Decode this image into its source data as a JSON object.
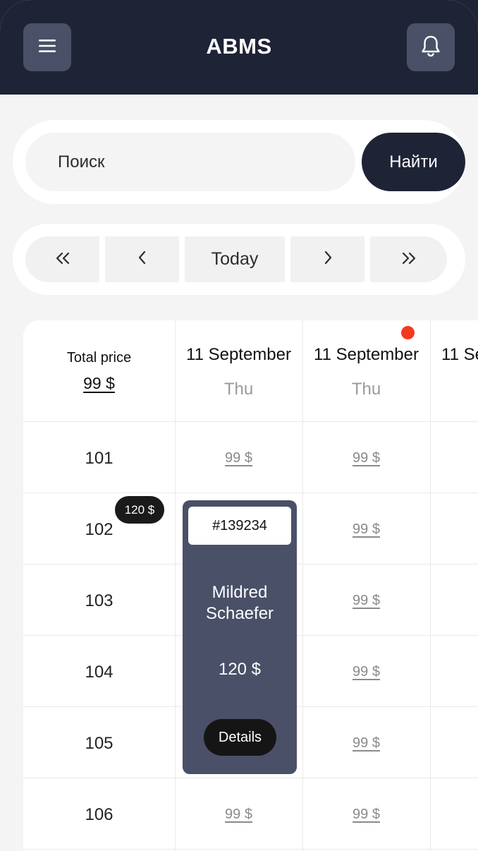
{
  "app": {
    "title": "ABMS"
  },
  "header": {
    "menu_icon": "menu-icon",
    "bell_icon": "bell-icon"
  },
  "search": {
    "placeholder": "Поиск",
    "button_label": "Найти"
  },
  "nav": {
    "first": "«",
    "prev": "‹",
    "today": "Today",
    "next": "›",
    "last": "»"
  },
  "grid": {
    "total_label": "Total price",
    "total_value": "99 $",
    "columns": [
      {
        "date": "11 September",
        "day": "Thu"
      },
      {
        "date": "11 September",
        "day": "Thu"
      },
      {
        "date": "11 Se",
        "day": ""
      }
    ],
    "rows": [
      {
        "room": "101",
        "prices": [
          "99 $",
          "99 $"
        ]
      },
      {
        "room": "102",
        "prices": [
          "",
          "99 $"
        ],
        "badge": "120 $"
      },
      {
        "room": "103",
        "prices": [
          "",
          "99 $"
        ]
      },
      {
        "room": "104",
        "prices": [
          "",
          "99 $"
        ]
      },
      {
        "room": "105",
        "prices": [
          "",
          "99 $"
        ]
      },
      {
        "room": "106",
        "prices": [
          "99 $",
          "99 $"
        ]
      }
    ]
  },
  "booking": {
    "id": "#139234",
    "guest_name": "Mildred Schaefer",
    "price": "120 $",
    "details_label": "Details"
  },
  "colors": {
    "dark": "#1f2336",
    "slate": "#4a5068",
    "alert": "#f23a1e"
  }
}
